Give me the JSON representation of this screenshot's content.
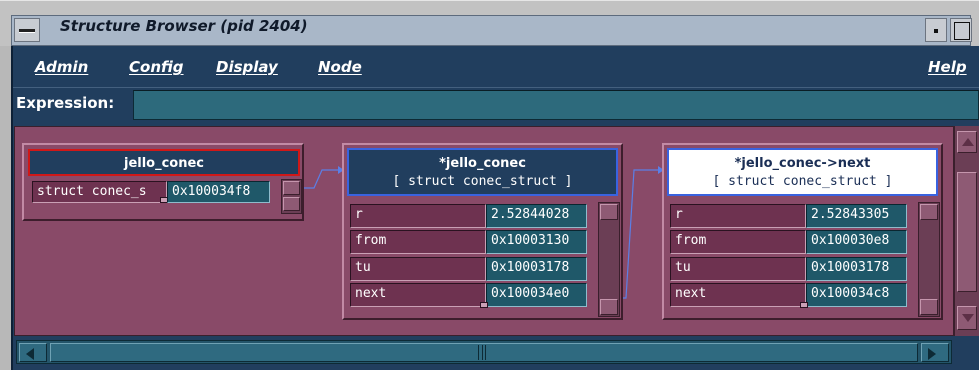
{
  "window": {
    "title": "Structure Browser (pid 2404)"
  },
  "menubar": {
    "items": [
      "Admin",
      "Config",
      "Display",
      "Node"
    ],
    "help": "Help"
  },
  "expression": {
    "label": "Expression:",
    "value": ""
  },
  "nodes": [
    {
      "title": "jello_conec",
      "type_value": "struct conec_s",
      "address": "0x100034f8"
    },
    {
      "title": "*jello_conec",
      "subtitle": "[ struct conec_struct  ]",
      "fields": [
        {
          "name": "r",
          "value": "2.52844028"
        },
        {
          "name": "from",
          "value": "0x10003130"
        },
        {
          "name": "tu",
          "value": "0x10003178"
        },
        {
          "name": "next",
          "value": "0x100034e0"
        }
      ]
    },
    {
      "title": "*jello_conec->next",
      "subtitle": "[ struct conec_struct  ]",
      "fields": [
        {
          "name": "r",
          "value": "2.52843305"
        },
        {
          "name": "from",
          "value": "0x100030e8"
        },
        {
          "name": "tu",
          "value": "0x10003178"
        },
        {
          "name": "next",
          "value": "0x100034c8"
        }
      ]
    }
  ],
  "colors": {
    "canvas": "#894a68",
    "menubar": "#213e5e",
    "selected_border": "#d01818",
    "link_line": "#5b7fe6",
    "highlight_header": "#ffffff"
  }
}
